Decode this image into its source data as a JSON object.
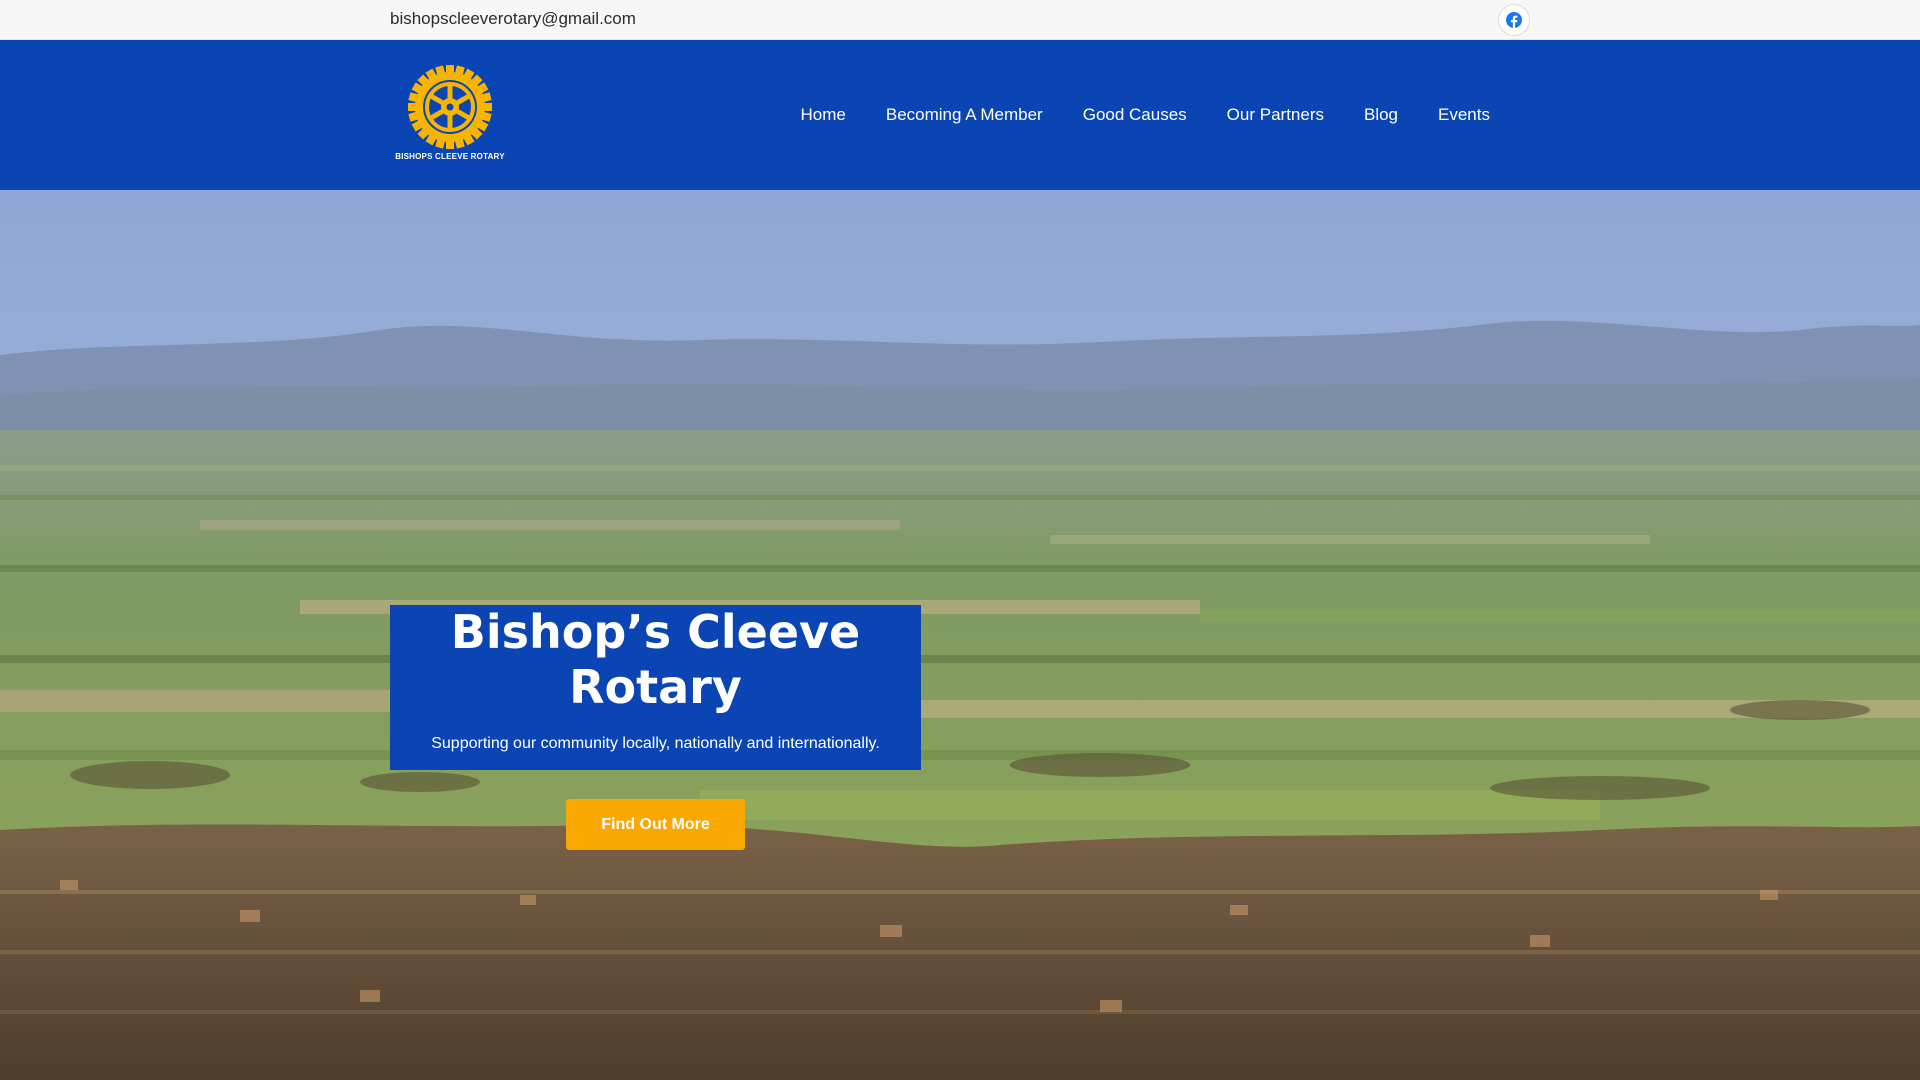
{
  "topbar": {
    "email": "bishopscleeverotary@gmail.com",
    "social": [
      {
        "icon": "facebook-icon",
        "color": "#1877f2"
      }
    ]
  },
  "header": {
    "background": "#0a45b3",
    "logo_text": "BISHOPS CLEEVE ROTARY",
    "logo_color": "#f7b500",
    "nav": [
      {
        "label": "Home"
      },
      {
        "label": "Becoming A Member"
      },
      {
        "label": "Good Causes"
      },
      {
        "label": "Our Partners"
      },
      {
        "label": "Blog"
      },
      {
        "label": "Events"
      }
    ]
  },
  "hero": {
    "title_line1": "Bishop’s Cleeve",
    "title_line2": "Rotary",
    "tagline": "Supporting our community locally, nationally and internationally.",
    "cta_label": "Find Out More",
    "cta_color": "#f8a800"
  }
}
